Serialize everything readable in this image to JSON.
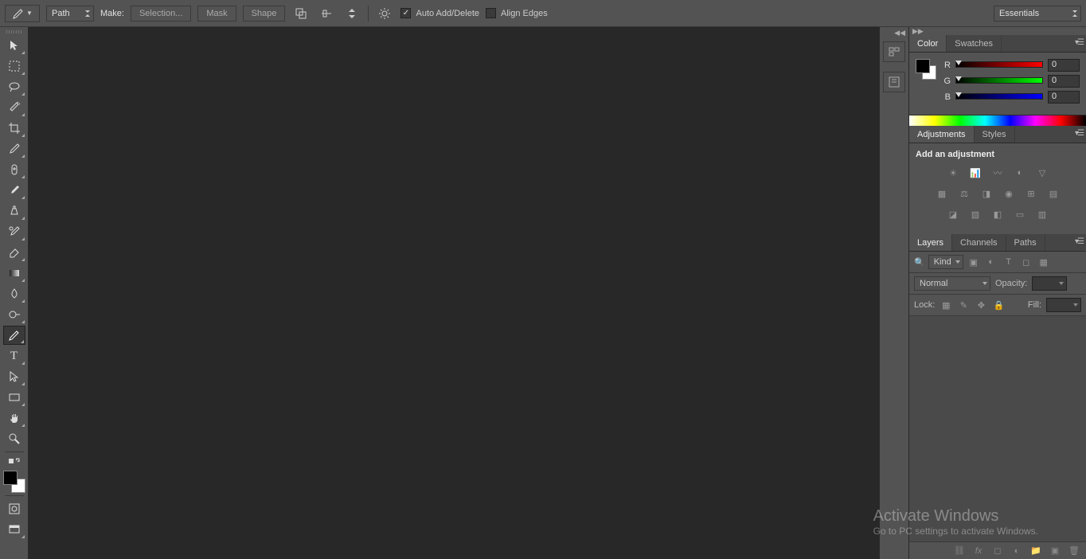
{
  "options": {
    "mode": "Path",
    "make_label": "Make:",
    "buttons": {
      "selection": "Selection...",
      "mask": "Mask",
      "shape": "Shape"
    },
    "auto_add_delete": "Auto Add/Delete",
    "align_edges": "Align Edges",
    "workspace": "Essentials"
  },
  "panels": {
    "color": {
      "tab_color": "Color",
      "tab_swatches": "Swatches",
      "r_label": "R",
      "r_value": "0",
      "g_label": "G",
      "g_value": "0",
      "b_label": "B",
      "b_value": "0"
    },
    "adjustments": {
      "tab_adjustments": "Adjustments",
      "tab_styles": "Styles",
      "title": "Add an adjustment"
    },
    "layers": {
      "tab_layers": "Layers",
      "tab_channels": "Channels",
      "tab_paths": "Paths",
      "kind": "Kind",
      "blend_mode": "Normal",
      "opacity_label": "Opacity:",
      "lock_label": "Lock:",
      "fill_label": "Fill:"
    }
  },
  "watermark": {
    "line1": "Activate Windows",
    "line2": "Go to PC settings to activate Windows."
  }
}
